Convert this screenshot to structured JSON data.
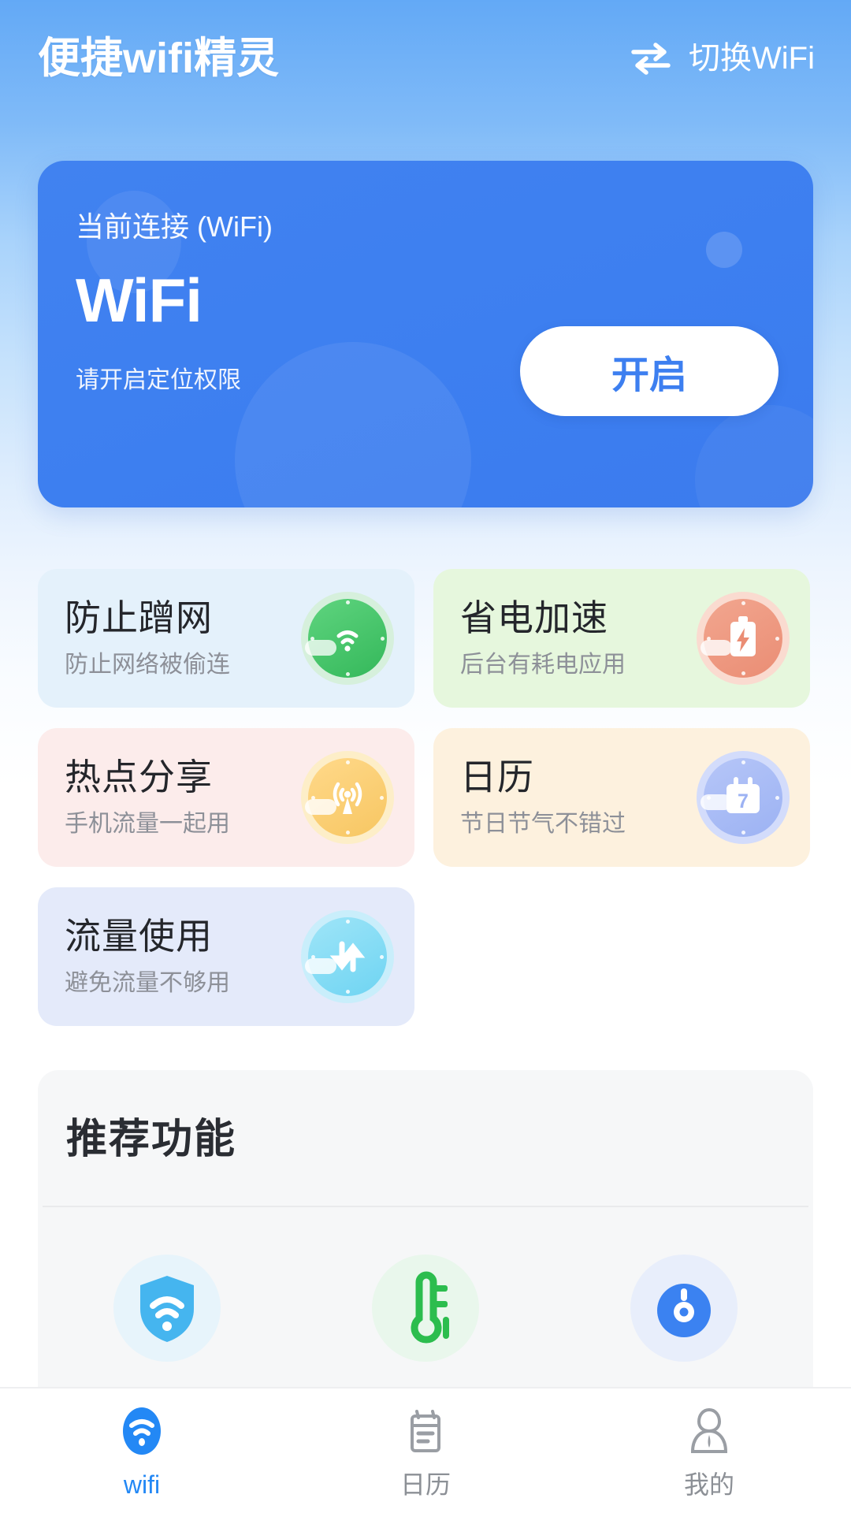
{
  "header": {
    "title": "便捷wifi精灵",
    "switch_wifi_label": "切换WiFi",
    "swap_icon": "swap-horizontal-icon"
  },
  "connection_card": {
    "label": "当前连接 (WiFi)",
    "ssid": "WiFi",
    "hint": "请开启定位权限",
    "button_label": "开启",
    "card_color": "#3d7ff0",
    "button_text_color": "#3d7ff0"
  },
  "features": [
    {
      "title": "防止蹭网",
      "desc": "防止网络被偷连",
      "tile_bg": "#e4f1fb",
      "icon": "shield-wifi-icon",
      "icon_halo": "#d6f0dc",
      "icon_core_from": "#5fd47f",
      "icon_core_to": "#34b85a"
    },
    {
      "title": "省电加速",
      "desc": "后台有耗电应用",
      "tile_bg": "#e6f7dd",
      "icon": "battery-bolt-icon",
      "icon_halo": "#fadbd0",
      "icon_core_from": "#f2a68f",
      "icon_core_to": "#ea8d74"
    },
    {
      "title": "热点分享",
      "desc": "手机流量一起用",
      "tile_bg": "#fceceb",
      "icon": "hotspot-broadcast-icon",
      "icon_halo": "#fdeec8",
      "icon_core_from": "#ffd98a",
      "icon_core_to": "#f7c662"
    },
    {
      "title": "日历",
      "desc": "节日节气不错过",
      "tile_bg": "#fdf1de",
      "icon": "calendar-7-icon",
      "icon_halo": "#d3dcfb",
      "icon_core_from": "#b6c6f8",
      "icon_core_to": "#9cb2f3",
      "calendar_day": "7"
    },
    {
      "title": "流量使用",
      "desc": "避免流量不够用",
      "tile_bg": "#e4eafa",
      "icon": "data-updown-icon",
      "icon_halo": "#c9eefb",
      "icon_core_from": "#9fe5f8",
      "icon_core_to": "#6ed4f2"
    }
  ],
  "recommended": {
    "title": "推荐功能",
    "panel_bg": "#f6f7f8",
    "items": [
      {
        "icon": "shield-wifi-blue-icon",
        "icon_bg": "#e7f4fb",
        "icon_color": "#45b5ef"
      },
      {
        "icon": "thermometer-icon",
        "icon_bg": "#e9f7ec",
        "icon_color": "#2cbd4e"
      },
      {
        "icon": "speed-gauge-icon",
        "icon_bg": "#e8eefb",
        "icon_color": "#3b82f1"
      }
    ]
  },
  "bottom_nav": {
    "active_color": "#2388f5",
    "inactive_color": "#8c9096",
    "items": [
      {
        "label": "wifi",
        "icon": "wifi-icon",
        "active": true
      },
      {
        "label": "日历",
        "icon": "calendar-icon",
        "active": false
      },
      {
        "label": "我的",
        "icon": "user-profile-icon",
        "active": false
      }
    ]
  }
}
